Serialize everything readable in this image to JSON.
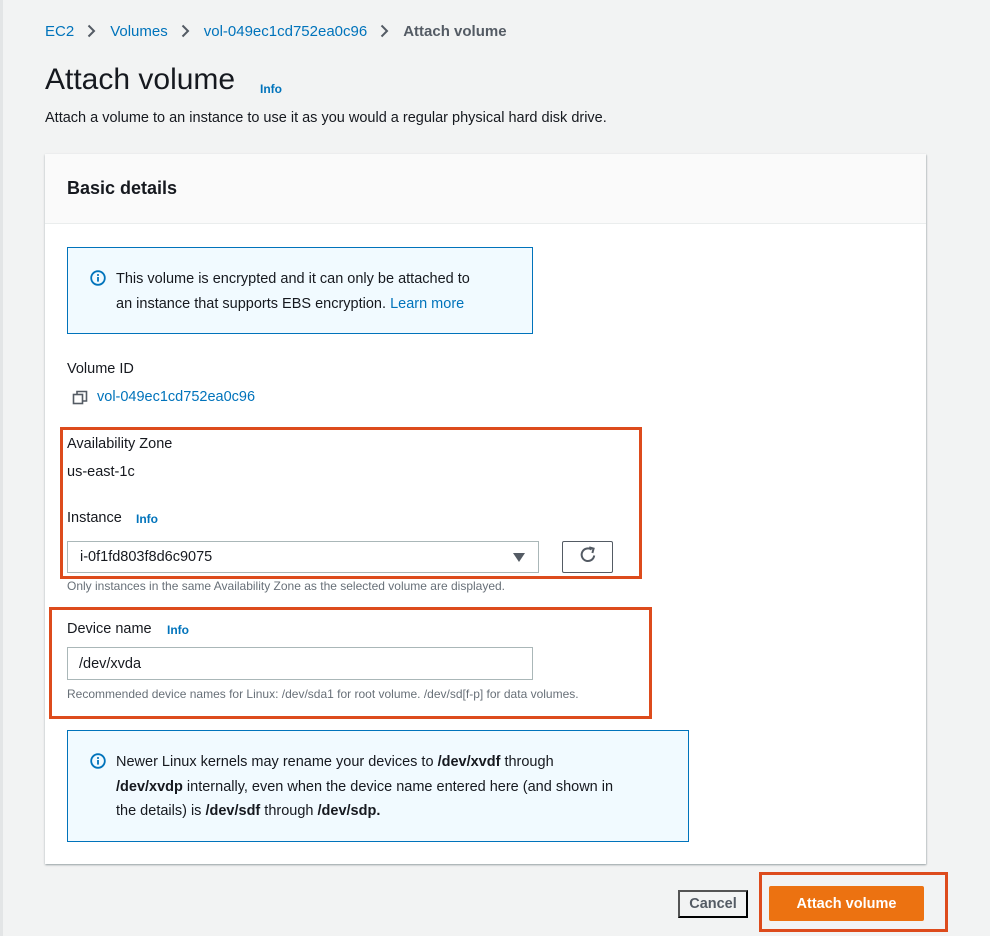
{
  "breadcrumb": {
    "items": [
      "EC2",
      "Volumes",
      "vol-049ec1cd752ea0c96"
    ],
    "current": "Attach volume"
  },
  "page": {
    "title": "Attach volume",
    "title_info": "Info",
    "description": "Attach a volume to an instance to use it as you would a regular physical hard disk drive."
  },
  "panel": {
    "header": "Basic details",
    "encryption_alert": {
      "line1": "This volume is encrypted and it can only be attached to",
      "line2": "an instance that supports EBS encryption.",
      "link": "Learn more"
    },
    "volume_id": {
      "label": "Volume ID",
      "value": "vol-049ec1cd752ea0c96"
    },
    "availability_zone": {
      "label": "Availability Zone",
      "value": "us-east-1c"
    },
    "instance": {
      "label": "Instance",
      "info": "Info",
      "selected": "i-0f1fd803f8d6c9075",
      "hint": "Only instances in the same Availability Zone as the selected volume are displayed."
    },
    "device_name": {
      "label": "Device name",
      "info": "Info",
      "value": "/dev/xvda",
      "hint": "Recommended device names for Linux: /dev/sda1 for root volume. /dev/sd[f-p] for data volumes."
    },
    "kernel_alert": {
      "p1": "Newer Linux kernels may rename your devices to ",
      "b1": "/dev/xvdf",
      "p2": " through",
      "b2": "/dev/xvdp",
      "p3": " internally, even when the device name entered here (and shown in",
      "p4": "the details) is ",
      "b3": "/dev/sdf",
      "p5": " through ",
      "b4": "/dev/sdp."
    }
  },
  "actions": {
    "cancel": "Cancel",
    "attach": "Attach volume"
  },
  "colors": {
    "link": "#0073bb",
    "primary": "#ec7211",
    "highlight": "#dd4b1c",
    "alert_bg": "#f1faff"
  }
}
